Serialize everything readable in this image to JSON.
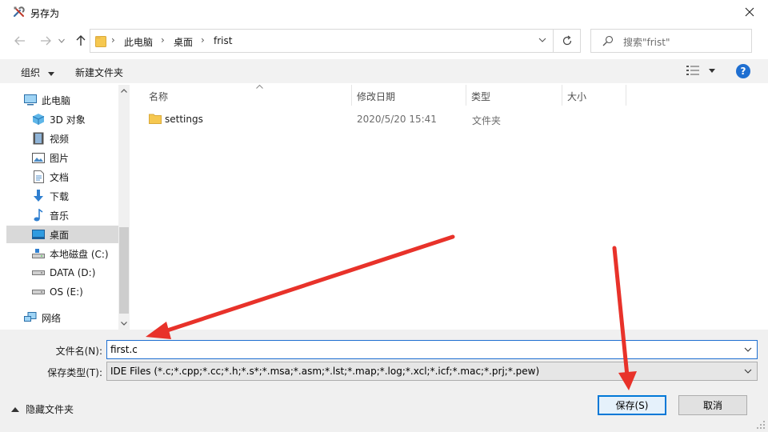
{
  "window": {
    "title": "另存为",
    "icon": "tools-icon",
    "close_icon": "close-icon"
  },
  "address_bar": {
    "back_icon": "arrow-left-icon",
    "forward_icon": "arrow-right-icon",
    "recent_icon": "chevron-down-icon",
    "up_icon": "arrow-up-icon",
    "breadcrumbs": [
      "此电脑",
      "桌面",
      "frist"
    ],
    "refresh_icon": "refresh-icon"
  },
  "search": {
    "placeholder": "搜索\"frist\"",
    "icon": "search-icon"
  },
  "toolbar": {
    "organize_label": "组织",
    "new_folder_label": "新建文件夹",
    "view_icon": "view-details-icon",
    "help_label": "?"
  },
  "nav": {
    "items": [
      {
        "label": "此电脑",
        "icon": "computer-icon",
        "selected": false
      },
      {
        "label": "3D 对象",
        "icon": "cube-icon",
        "selected": false
      },
      {
        "label": "视频",
        "icon": "video-icon",
        "selected": false
      },
      {
        "label": "图片",
        "icon": "picture-icon",
        "selected": false
      },
      {
        "label": "文档",
        "icon": "document-icon",
        "selected": false
      },
      {
        "label": "下载",
        "icon": "download-icon",
        "selected": false
      },
      {
        "label": "音乐",
        "icon": "music-icon",
        "selected": false
      },
      {
        "label": "桌面",
        "icon": "desktop-icon",
        "selected": true
      },
      {
        "label": "本地磁盘 (C:)",
        "icon": "drive-c-icon",
        "selected": false
      },
      {
        "label": "DATA (D:)",
        "icon": "drive-icon",
        "selected": false
      },
      {
        "label": "OS (E:)",
        "icon": "drive-icon",
        "selected": false
      },
      {
        "label": "网络",
        "icon": "network-icon",
        "selected": false
      }
    ]
  },
  "file_list": {
    "columns": [
      "名称",
      "修改日期",
      "类型",
      "大小"
    ],
    "rows": [
      {
        "name": "settings",
        "modified": "2020/5/20 15:41",
        "type": "文件夹",
        "size": "",
        "icon": "folder-icon"
      }
    ]
  },
  "form": {
    "filename_label": "文件名(N):",
    "filename_value": "first.c",
    "filetype_label": "保存类型(T):",
    "filetype_value": "IDE Files (*.c;*.cpp;*.cc;*.h;*.s*;*.msa;*.asm;*.lst;*.map;*.log;*.xcl;*.icf;*.mac;*.prj;*.pew)",
    "hide_folders_label": "隐藏文件夹",
    "save_label": "保存(S)",
    "cancel_label": "取消"
  },
  "annotations": {
    "arrow_color": "#e8322a"
  },
  "colors": {
    "accent": "#0078d7",
    "selected_bg": "#d9d9d9",
    "folder": "#f6c850"
  }
}
